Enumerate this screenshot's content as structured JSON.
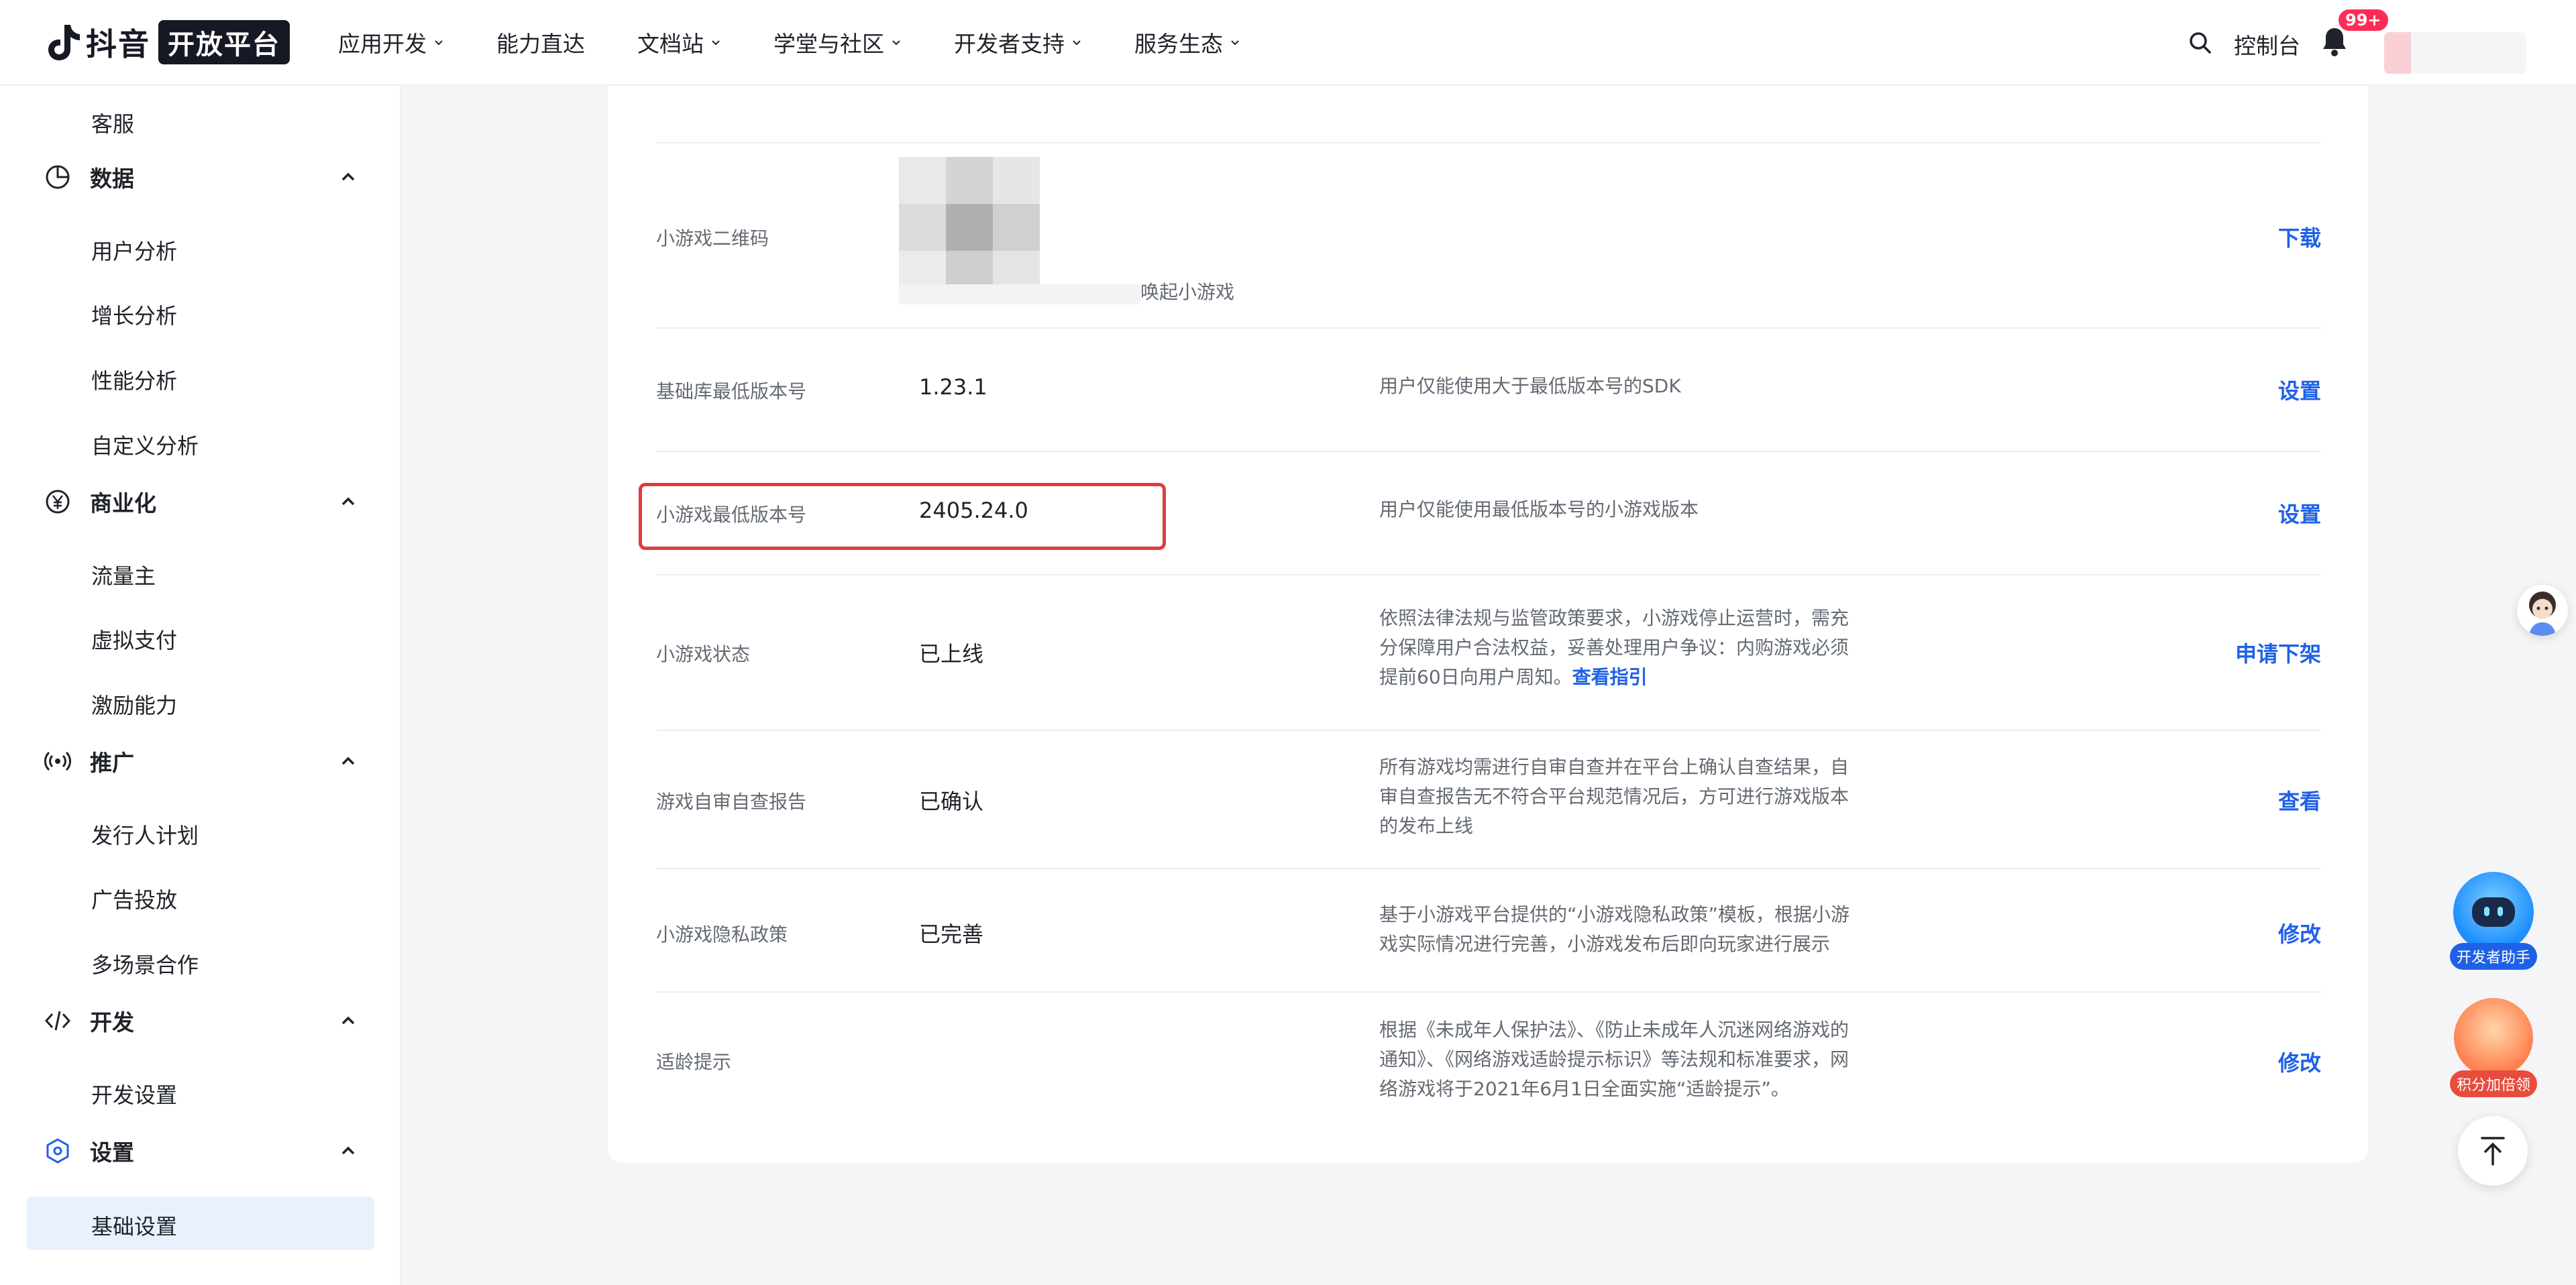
{
  "header": {
    "logo_text": "抖音",
    "logo_badge": "开放平台",
    "nav": [
      {
        "label": "应用开发",
        "has_dropdown": true
      },
      {
        "label": "能力直达",
        "has_dropdown": false
      },
      {
        "label": "文档站",
        "has_dropdown": true
      },
      {
        "label": "学堂与社区",
        "has_dropdown": true
      },
      {
        "label": "开发者支持",
        "has_dropdown": true
      },
      {
        "label": "服务生态",
        "has_dropdown": true
      }
    ],
    "console_label": "控制台",
    "notification_count": "99+"
  },
  "sidebar": {
    "top_item": "客服",
    "groups": [
      {
        "label": "数据",
        "icon": "pie-chart-icon",
        "items": [
          "用户分析",
          "增长分析",
          "性能分析",
          "自定义分析"
        ]
      },
      {
        "label": "商业化",
        "icon": "yen-icon",
        "items": [
          "流量主",
          "虚拟支付",
          "激励能力"
        ]
      },
      {
        "label": "推广",
        "icon": "broadcast-icon",
        "items": [
          "发行人计划",
          "广告投放",
          "多场景合作"
        ]
      },
      {
        "label": "开发",
        "icon": "code-icon",
        "items": [
          "开发设置"
        ]
      },
      {
        "label": "设置",
        "icon": "hexagon-settings-icon",
        "items": [
          "基础设置"
        ]
      }
    ],
    "active_item": "基础设置"
  },
  "settings": {
    "rows": [
      {
        "label": "小游戏二维码",
        "value": "",
        "desc": "",
        "action": "下载",
        "qr_caption": "唤起小游戏"
      },
      {
        "label": "基础库最低版本号",
        "value": "1.23.1",
        "desc": "用户仅能使用大于最低版本号的SDK",
        "action": "设置"
      },
      {
        "label": "小游戏最低版本号",
        "value": "2405.24.0",
        "desc": "用户仅能使用最低版本号的小游戏版本",
        "action": "设置"
      },
      {
        "label": "小游戏状态",
        "value": "已上线",
        "desc": "依照法律法规与监管政策要求，小游戏停止运营时，需充分保障用户合法权益，妥善处理用户争议：内购游戏必须提前60日向用户周知。",
        "desc_link": "查看指引",
        "action": "申请下架"
      },
      {
        "label": "游戏自审自查报告",
        "value": "已确认",
        "desc": "所有游戏均需进行自审自查并在平台上确认自查结果，自审自查报告无不符合平台规范情况后，方可进行游戏版本的发布上线",
        "action": "查看"
      },
      {
        "label": "小游戏隐私政策",
        "value": "已完善",
        "desc": "基于小游戏平台提供的“小游戏隐私政策”模板，根据小游戏实际情况进行完善，小游戏发布后即向玩家进行展示",
        "action": "修改"
      },
      {
        "label": "适龄提示",
        "value": "",
        "desc": "根据《未成年人保护法》、《防止未成年人沉迷网络游戏的通知》、《网络游戏适龄提示标识》等法规和标准要求，网络游戏将于2021年6月1日全面实施“适龄提示”。",
        "action": "修改"
      }
    ]
  },
  "floating": {
    "assistant_label": "开发者助手",
    "points_label": "积分加倍领"
  },
  "colors": {
    "accent": "#1f61e6",
    "highlight_border": "#e33b3b",
    "badge": "#fe2c55"
  }
}
